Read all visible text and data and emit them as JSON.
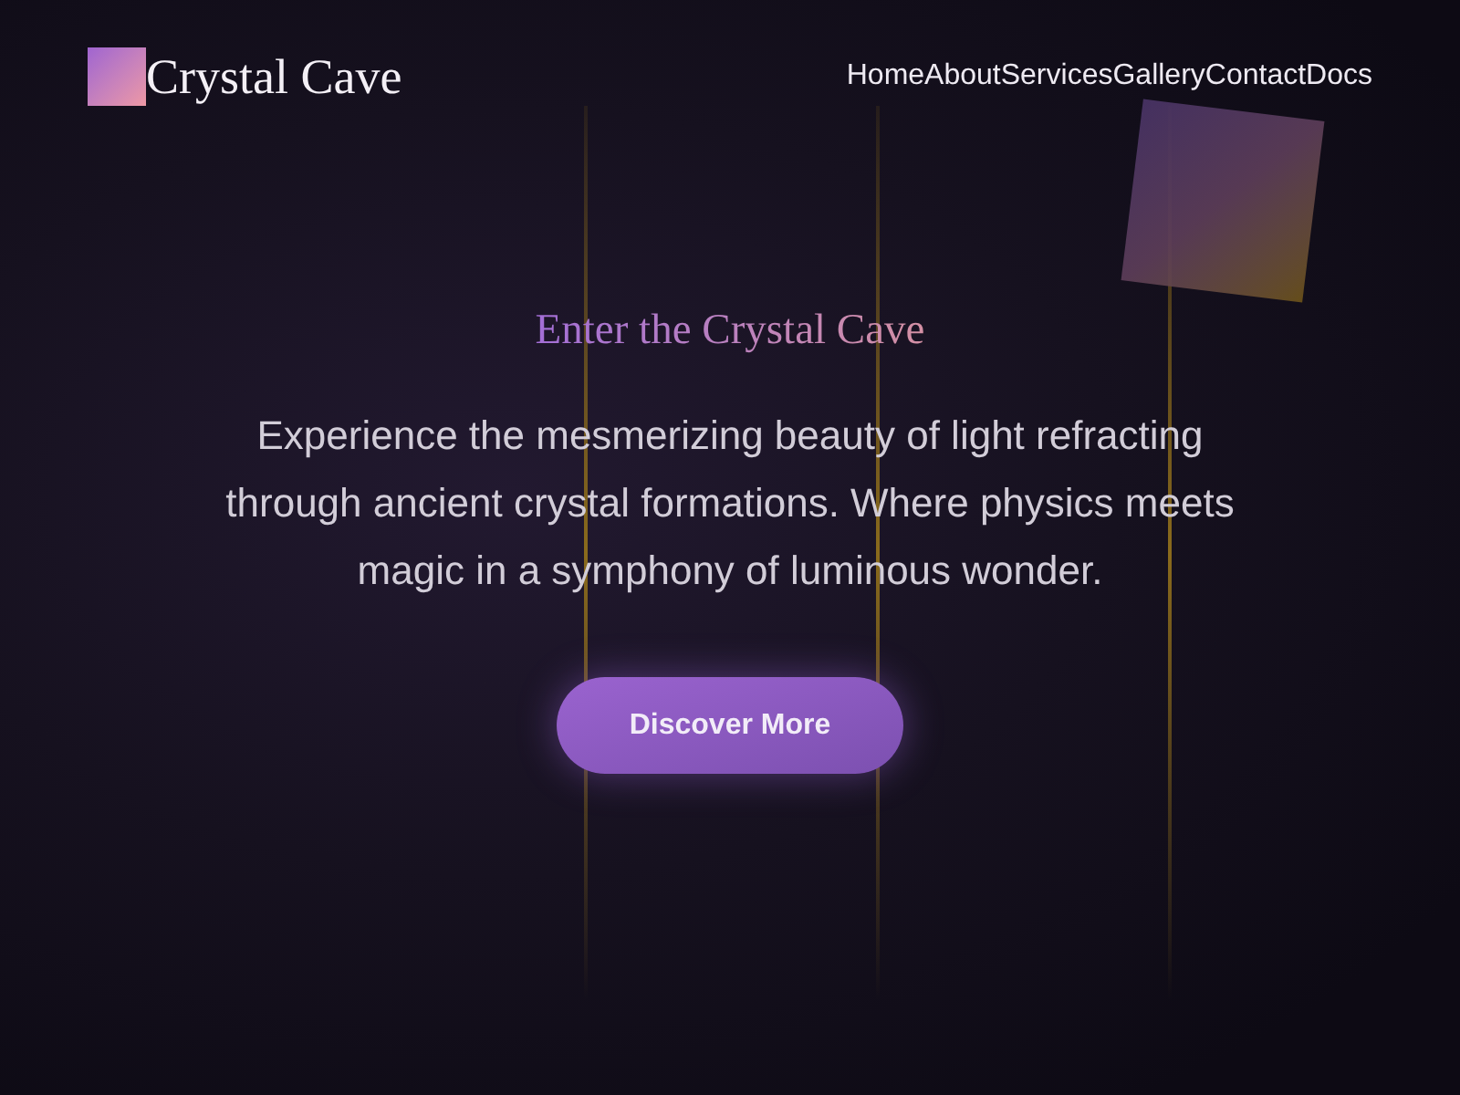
{
  "logo": {
    "text": "Crystal Cave"
  },
  "nav": [
    "Home",
    "About",
    "Services",
    "Gallery",
    "Contact",
    "Docs"
  ],
  "hero": {
    "title": "Enter the Crystal Cave",
    "text": "Experience the mesmerizing beauty of light refracting through ancient crystal formations. Where physics meets magic in a symphony of luminous wonder.",
    "button": "Discover More"
  }
}
